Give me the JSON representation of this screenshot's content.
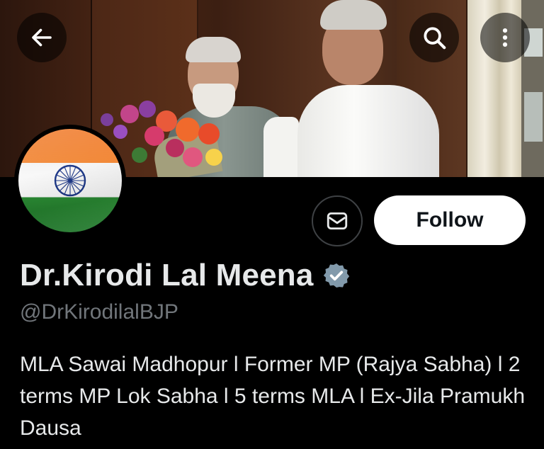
{
  "profile": {
    "display_name": "Dr.Kirodi Lal Meena",
    "handle": "@DrKirodilalBJP",
    "bio": "MLA Sawai Madhopur l Former MP (Rajya Sabha) l 2 terms MP Lok Sabha l 5 terms MLA l Ex-Jila Pramukh Dausa",
    "verified": true
  },
  "actions": {
    "follow_label": "Follow"
  },
  "icons": {
    "back": "arrow-left-icon",
    "search": "search-icon",
    "more": "more-vertical-icon",
    "message": "envelope-icon",
    "verified": "verified-badge-icon"
  },
  "colors": {
    "background": "#000000",
    "follow_bg": "#ffffff",
    "follow_text": "#0f1419",
    "handle_text": "#71767b",
    "verified_badge": "#829aab",
    "saffron": "#f07a2a",
    "green": "#2c8f35",
    "chakra_blue": "#1f3a8a"
  }
}
